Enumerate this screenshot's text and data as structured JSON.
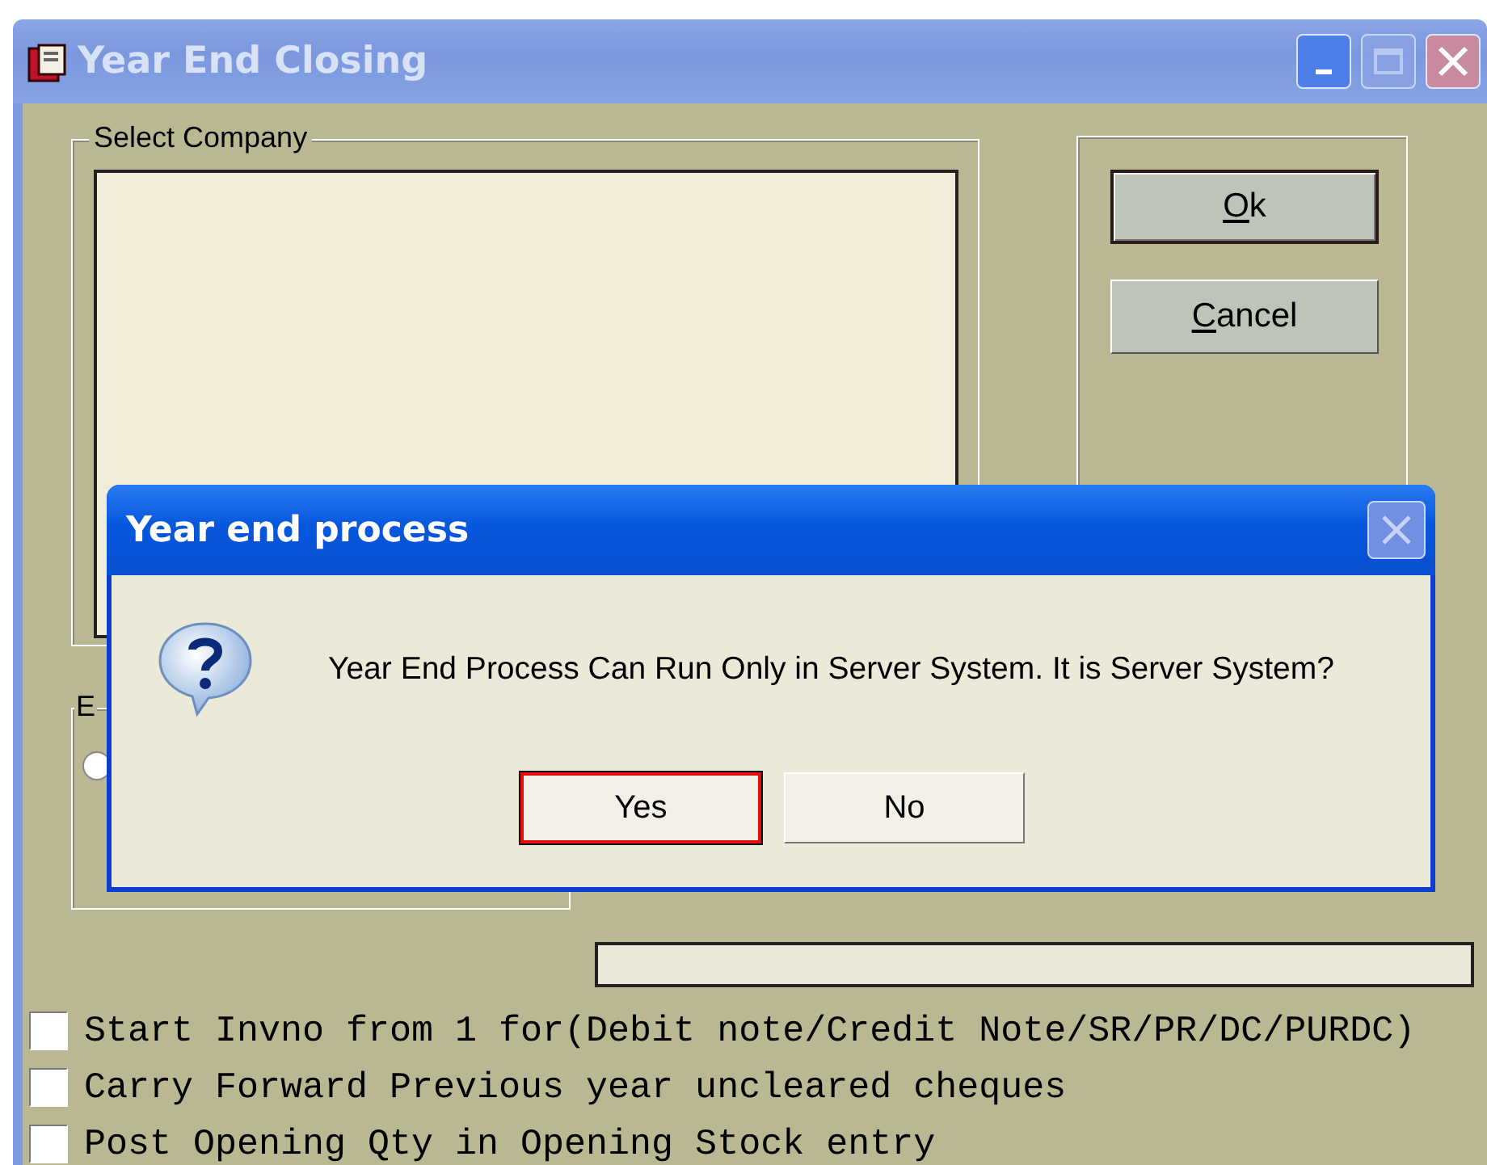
{
  "window": {
    "title": "Year End Closing",
    "active": false
  },
  "select_company": {
    "label": "Select Company"
  },
  "buttons": [
    {
      "label": "Ok",
      "underline_first": true,
      "default": true
    },
    {
      "label": "Cancel",
      "underline_first": true,
      "default": false
    }
  ],
  "option_group": {
    "label": "E",
    "radio": {
      "selected": false
    }
  },
  "progress": {
    "level": 0
  },
  "options": [
    {
      "label": "Start Invno from 1 for(Debit note/Credit Note/SR/PR/DC/PURDC)",
      "checked": false
    },
    {
      "label": "Carry Forward Previous year uncleared cheques",
      "checked": false
    },
    {
      "label": "Post Opening Qty in Opening Stock entry",
      "checked": false
    }
  ],
  "dialog": {
    "title": "Year end process",
    "message": "Year End Process Can Run Only in Server System. It is Server System?",
    "buttons": [
      {
        "label": "Yes",
        "focused": true
      },
      {
        "label": "No",
        "focused": false
      }
    ]
  }
}
